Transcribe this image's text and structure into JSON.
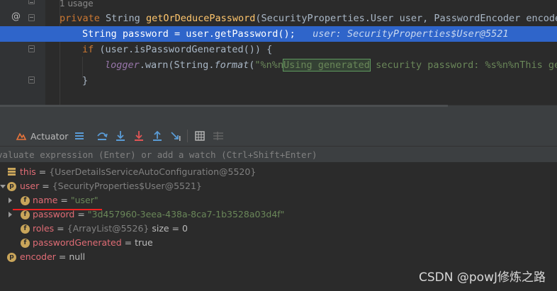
{
  "editor": {
    "usage_hint": "1 usage",
    "line1": {
      "kw": "private",
      "type": " String ",
      "method": "getOrDeducePassword",
      "rest": "(SecurityProperties.User user, PasswordEncoder encoder"
    },
    "line2": {
      "code": "String password = user.getPassword();",
      "hint": "user: SecurityProperties$User@5521"
    },
    "line3": {
      "kw": "if",
      "rest": " (user.isPasswordGenerated()) {"
    },
    "line4": {
      "field": "logger",
      "warn": ".warn(String.",
      "format": "format",
      "open": "(",
      "str1": "\"%n%n",
      "boxed": "Using generated",
      "str2": " security password: %s%n%nThis gen"
    },
    "line5": "}"
  },
  "debug_toolbar": {
    "actuator_label": "Actuator",
    "buttons": [
      "show-execution-point",
      "step-over",
      "step-into",
      "force-step-into",
      "step-out",
      "run-to-cursor",
      "evaluate-expression",
      "trace"
    ]
  },
  "expression": {
    "placeholder": "valuate expression (Enter) or add a watch (Ctrl+Shift+Enter)"
  },
  "variables": [
    {
      "name": "this",
      "eq": " = ",
      "value": "{UserDetailsServiceAutoConfiguration@5520}"
    },
    {
      "name": "user",
      "eq": " = ",
      "value": "{SecurityProperties$User@5521}"
    },
    {
      "name": "name",
      "eq": " = ",
      "value": "\"user\""
    },
    {
      "name": "password",
      "eq": " = ",
      "value": "\"3d457960-3eea-438a-8ca7-1b3528a03d4f\""
    },
    {
      "name": "roles",
      "eq": " = ",
      "value": "{ArrayList@5526}",
      "extra": "  size = 0"
    },
    {
      "name": "passwordGenerated",
      "eq": " = ",
      "value": "true"
    },
    {
      "name": "encoder",
      "eq": " = ",
      "value": "null"
    }
  ],
  "watermark": "CSDN @powJ修炼之路",
  "colors": {
    "keyword": "#cc7832",
    "method": "#ffc66d",
    "string": "#6a8759",
    "selection": "#2f65ca",
    "var_name": "#e06c75",
    "field_badge": "#c9a55a"
  }
}
